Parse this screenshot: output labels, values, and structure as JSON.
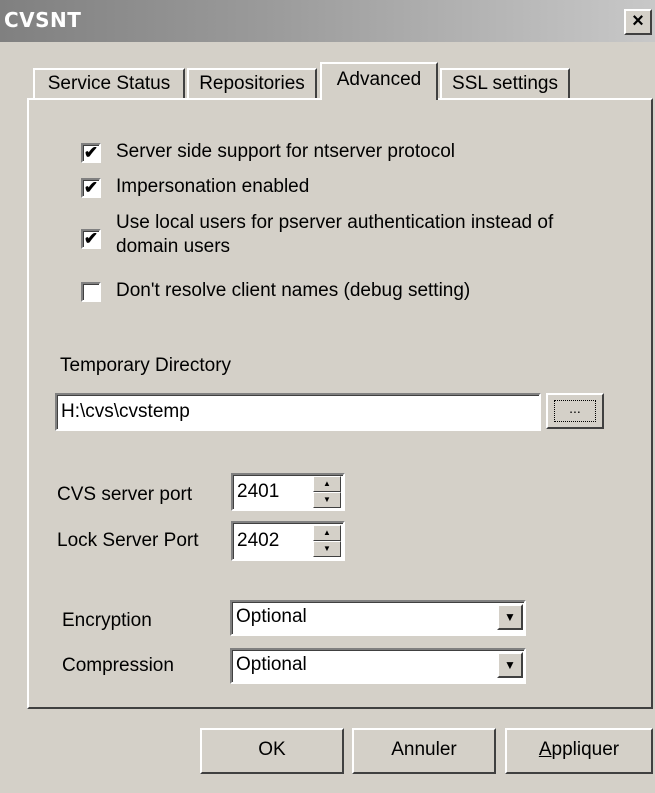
{
  "window": {
    "title": "CVSNT",
    "close_glyph": "×"
  },
  "tabs": [
    {
      "label": "Service Status",
      "active": false
    },
    {
      "label": "Repositories",
      "active": false
    },
    {
      "label": "Advanced",
      "active": true
    },
    {
      "label": "SSL settings",
      "active": false
    }
  ],
  "options": [
    {
      "label": "Server side support for ntserver protocol",
      "checked": true
    },
    {
      "label": "Impersonation enabled",
      "checked": true
    },
    {
      "label_line1": "Use local users for pserver authentication instead of",
      "label_line2": "domain users",
      "checked": true
    },
    {
      "label": "Don't resolve client names (debug setting)",
      "checked": false
    }
  ],
  "temp_dir": {
    "label": "Temporary Directory",
    "value": "H:\\cvs\\cvstemp",
    "browse_label": "..."
  },
  "cvs_port": {
    "label": "CVS server port",
    "value": "2401"
  },
  "lock_port": {
    "label": "Lock Server Port",
    "value": "2402"
  },
  "encryption": {
    "label": "Encryption",
    "value": "Optional"
  },
  "compression": {
    "label": "Compression",
    "value": "Optional"
  },
  "buttons": {
    "ok": "OK",
    "cancel": "Annuler",
    "apply": "Appliquer"
  },
  "colors": {
    "face": "#d4d0c8",
    "title_gradient_start": "#808080",
    "title_gradient_end": "#c8c8c8"
  },
  "icons": {
    "check": "✔",
    "spin_up": "▲",
    "spin_down": "▼",
    "dropdown": "▼"
  }
}
